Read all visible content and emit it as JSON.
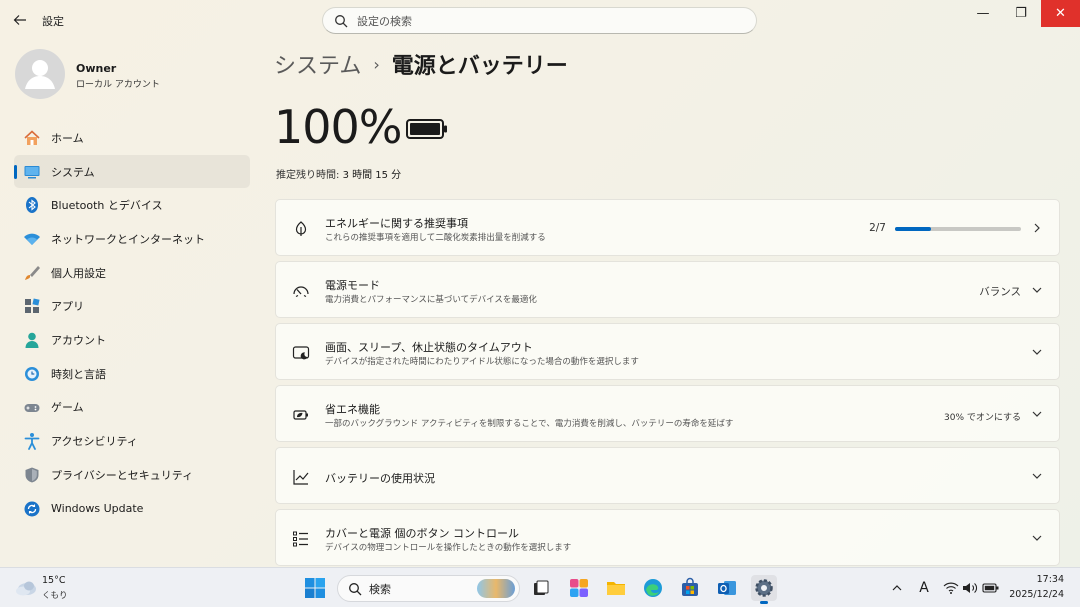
{
  "window": {
    "title": "設定",
    "search_placeholder": "設定の検索",
    "minimize": "—",
    "maximize": "❐",
    "close": "✕"
  },
  "profile": {
    "name": "Owner",
    "account_type": "ローカル アカウント"
  },
  "sidebar": {
    "items": [
      {
        "label": "ホーム",
        "icon": "home-icon"
      },
      {
        "label": "システム",
        "icon": "system-icon",
        "active": true
      },
      {
        "label": "Bluetooth とデバイス",
        "icon": "bluetooth-icon"
      },
      {
        "label": "ネットワークとインターネット",
        "icon": "network-icon"
      },
      {
        "label": "個人用設定",
        "icon": "brush-icon"
      },
      {
        "label": "アプリ",
        "icon": "apps-icon"
      },
      {
        "label": "アカウント",
        "icon": "account-icon"
      },
      {
        "label": "時刻と言語",
        "icon": "time-language-icon"
      },
      {
        "label": "ゲーム",
        "icon": "gamepad-icon"
      },
      {
        "label": "アクセシビリティ",
        "icon": "accessibility-icon"
      },
      {
        "label": "プライバシーとセキュリティ",
        "icon": "shield-icon"
      },
      {
        "label": "Windows Update",
        "icon": "update-icon"
      }
    ]
  },
  "breadcrumb": {
    "parent": "システム",
    "separator": "›",
    "current": "電源とバッテリー"
  },
  "battery": {
    "percent": "100%",
    "remaining_label": "推定残り時間:",
    "remaining_value": "3 時間 15 分"
  },
  "cards": {
    "energy": {
      "title": "エネルギーに関する推奨事項",
      "desc": "これらの推奨事項を適用して二酸化炭素排出量を削減する",
      "progress_label": "2/7",
      "progress_fraction": 0.2857
    },
    "power_mode": {
      "title": "電源モード",
      "desc": "電力消費とパフォーマンスに基づいてデバイスを最適化",
      "value": "バランス"
    },
    "screen_sleep": {
      "title": "画面、スリープ、休止状態のタイムアウト",
      "desc": "デバイスが指定された時間にわたりアイドル状態になった場合の動作を選択します"
    },
    "energy_saver": {
      "title": "省エネ機能",
      "desc": "一部のバックグラウンド アクティビティを制限することで、電力消費を削減し、バッテリーの寿命を延ばす",
      "value": "30% でオンにする"
    },
    "battery_usage": {
      "title": "バッテリーの使用状況"
    },
    "lid_buttons": {
      "title": "カバーと電源 個のボタン コントロール",
      "desc": "デバイスの物理コントロールを操作したときの動作を選択します"
    }
  },
  "taskbar": {
    "weather_temp": "15°C",
    "weather_condition": "くもり",
    "search_label": "検索",
    "ime_indicator": "A",
    "time": "17:34",
    "date": "2025/12/24"
  },
  "colors": {
    "accent": "#0067c0",
    "close_button": "#e0312b"
  }
}
